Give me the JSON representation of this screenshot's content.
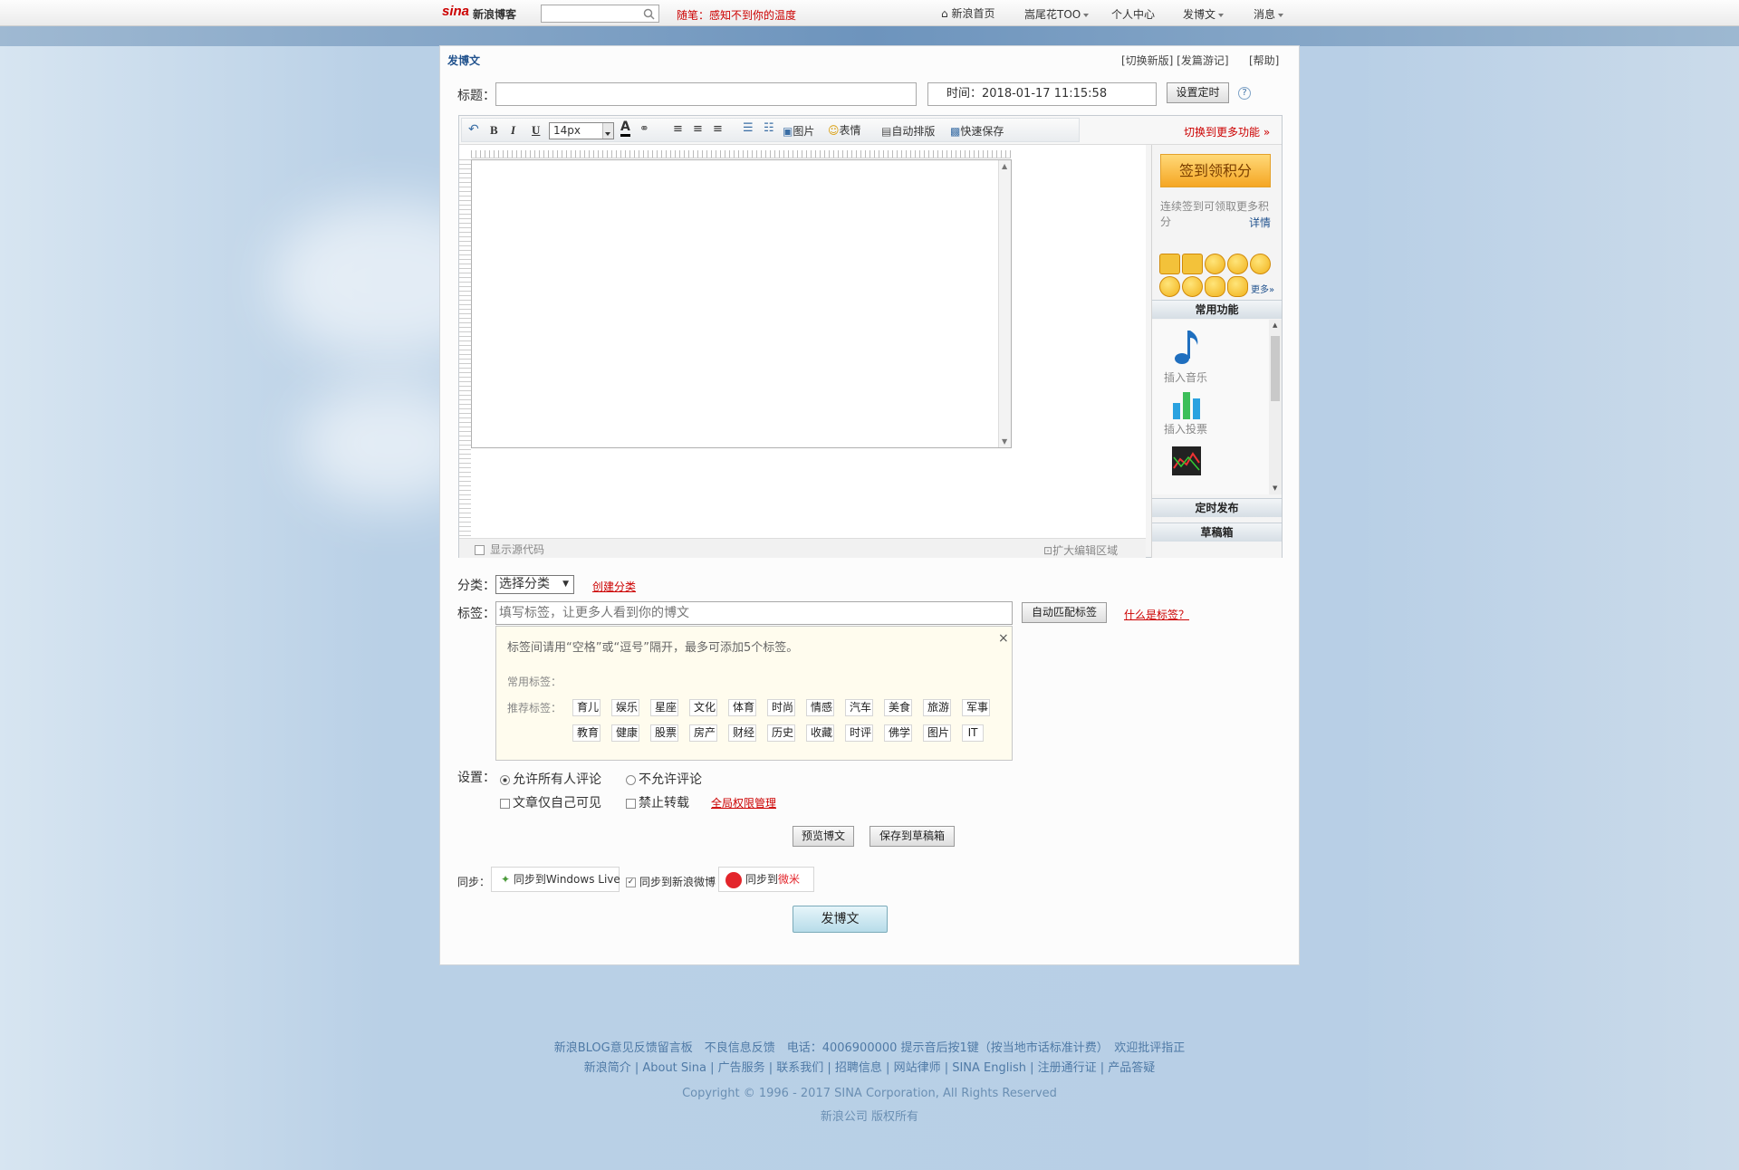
{
  "topbar": {
    "logo_sina": "sina",
    "logo_text": "新浪博客",
    "note": "随笔：感知不到你的温度",
    "nav": [
      "新浪首页",
      "嵩尾花TOO",
      "个人中心",
      "发博文",
      "消息"
    ]
  },
  "header": {
    "title": "发博文",
    "links": "[切换新版] [发篇游记]",
    "help": "[帮助]"
  },
  "form": {
    "title_label": "标题：",
    "time_label": "时间：",
    "time_value": "2018-01-17 11:15:58",
    "schedule_button": "设置定时",
    "help_icon": "?"
  },
  "toolbar": {
    "font_size": "14px",
    "image": "图片",
    "emoji": "表情",
    "auto_layout": "自动排版",
    "quick_save": "快速保存",
    "more": "切换到更多功能"
  },
  "editor": {
    "show_source": "显示源代码",
    "expand": "扩大编辑区域"
  },
  "sidebar": {
    "checkin": "签到领积分",
    "checkin_desc": "连续签到可领取更多积分",
    "details": "详情",
    "more_emoji": "更多»",
    "common_title": "常用功能",
    "insert_music": "插入音乐",
    "insert_vote": "插入投票",
    "scheduled": "定时发布",
    "drafts": "草稿箱"
  },
  "category": {
    "label": "分类：",
    "select": "选择分类",
    "create": "创建分类"
  },
  "tags": {
    "label": "标签：",
    "placeholder": "填写标签，让更多人看到你的博文",
    "auto_match": "自动匹配标签",
    "what_is": "什么是标签？",
    "hint": "标签间请用“空格”或“逗号”隔开，最多可添加5个标签。",
    "close": "×",
    "common_label": "常用标签：",
    "recommend_label": "推荐标签：",
    "row1": [
      "育儿",
      "娱乐",
      "星座",
      "文化",
      "体育",
      "时尚",
      "情感",
      "汽车",
      "美食",
      "旅游",
      "军事"
    ],
    "row2": [
      "教育",
      "健康",
      "股票",
      "房产",
      "财经",
      "历史",
      "收藏",
      "时评",
      "佛学",
      "图片",
      "IT"
    ]
  },
  "settings": {
    "label": "设置：",
    "allow_all": "允许所有人评论",
    "disallow": "不允许评论",
    "only_me": "文章仅自己可见",
    "no_repost": "禁止转载",
    "global_perm": "全局权限管理"
  },
  "actions": {
    "preview": "预览博文",
    "save_draft": "保存到草稿箱",
    "publish": "发博文"
  },
  "sync": {
    "label": "同步：",
    "windows_live": "同步到Windows Live",
    "weibo": "同步到新浪微博",
    "weimi_prefix": "同步到",
    "weimi": "微米"
  },
  "footer": {
    "line1": "新浪BLOG意见反馈留言板　不良信息反馈　电话：4006900000 提示音后按1键（按当地市话标准计费）　欢迎批评指正",
    "line2": "新浪简介 | About Sina | 广告服务 | 联系我们 | 招聘信息 | 网站律师 | SINA English | 注册通行证 | 产品答疑",
    "copyright": "Copyright © 1996 - 2017 SINA Corporation, All Rights Reserved",
    "rights": "新浪公司 版权所有"
  }
}
